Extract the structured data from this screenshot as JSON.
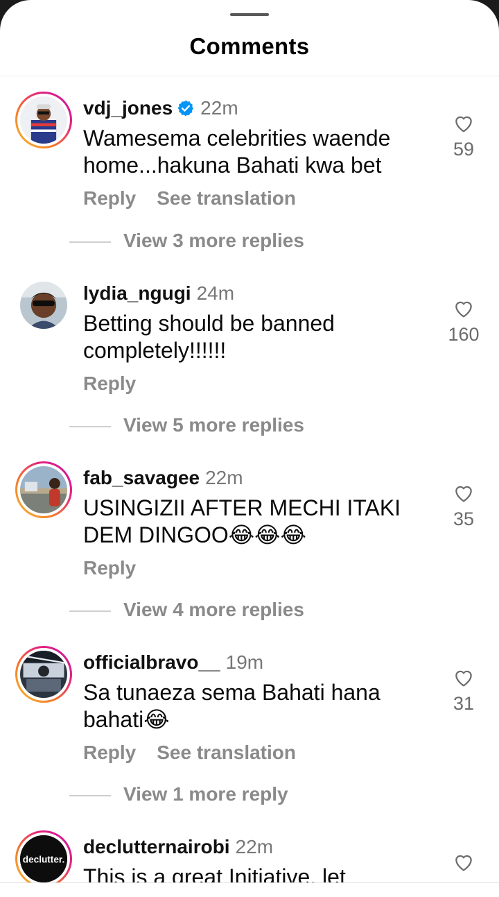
{
  "sheet": {
    "title": "Comments"
  },
  "comments": [
    {
      "username": "vdj_jones",
      "verified": true,
      "time": "22m",
      "text": "Wamesema celebrities waende home...hakuna Bahati kwa bet",
      "reply_label": "Reply",
      "translate_label": "See translation",
      "view_replies": "View 3 more replies",
      "likes": "59"
    },
    {
      "username": "lydia_ngugi",
      "time": "24m",
      "text": "Betting should be banned completely!!!!!!",
      "reply_label": "Reply",
      "view_replies": "View 5 more replies",
      "likes": "160"
    },
    {
      "username": "fab_savagee",
      "time": "22m",
      "text": "USINGIZII AFTER MECHI ITAKI DEM DINGOO😂😂😂",
      "reply_label": "Reply",
      "view_replies": "View 4 more replies",
      "likes": "35"
    },
    {
      "username": "officialbravo__",
      "time": "19m",
      "text": "Sa tunaeza sema Bahati hana bahati😂",
      "reply_label": "Reply",
      "translate_label": "See translation",
      "view_replies": "View 1 more reply",
      "likes": "31"
    },
    {
      "username": "declutternairobi",
      "time": "22m",
      "text": "This is a great Initiative, let",
      "avatar_text": "declutter."
    }
  ],
  "colors": {
    "verified": "#0095f6",
    "muted": "#8a8a8a",
    "ring": "#e5207e"
  },
  "icons": {
    "like": "heart-outline-icon",
    "verified": "verified-badge-icon"
  }
}
